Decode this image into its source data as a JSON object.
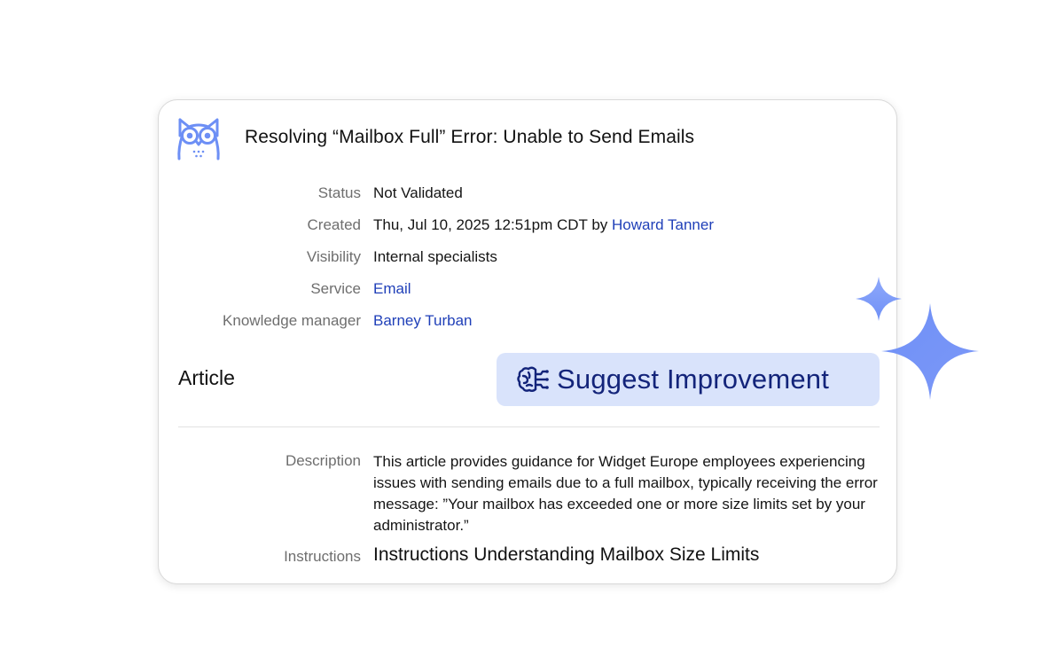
{
  "article": {
    "title": "Resolving “Mailbox Full” Error: Unable to Send Emails",
    "logo_icon": "owl-icon"
  },
  "meta": {
    "status_label": "Status",
    "status_value": "Not Validated",
    "created_label": "Created",
    "created_value": "Thu, Jul 10, 2025 12:51pm CDT by",
    "created_by": "Howard Tanner",
    "visibility_label": "Visibility",
    "visibility_value": "Internal specialists",
    "service_label": "Service",
    "service_value": "Email",
    "manager_label": "Knowledge manager",
    "manager_value": "Barney Turban"
  },
  "section": {
    "heading": "Article",
    "suggest_label": "Suggest Improvement",
    "suggest_icon": "brain-circuit-icon"
  },
  "body": {
    "description_label": "Description",
    "description_value": "This article provides guidance for Widget Europe employees experiencing issues with sending emails due to a full mailbox, typically receiving the error message: ”Your mailbox has exceeded one or more size limits set by your administrator.”",
    "instructions_label": "Instructions",
    "instructions_value": "Instructions Understanding Mailbox Size Limits"
  },
  "colors": {
    "accent": "#6d8ff5",
    "link": "#1f3fb8",
    "button_bg": "#d9e3fb",
    "button_text": "#13247a"
  },
  "decoration": {
    "icon": "sparkle-icon"
  }
}
